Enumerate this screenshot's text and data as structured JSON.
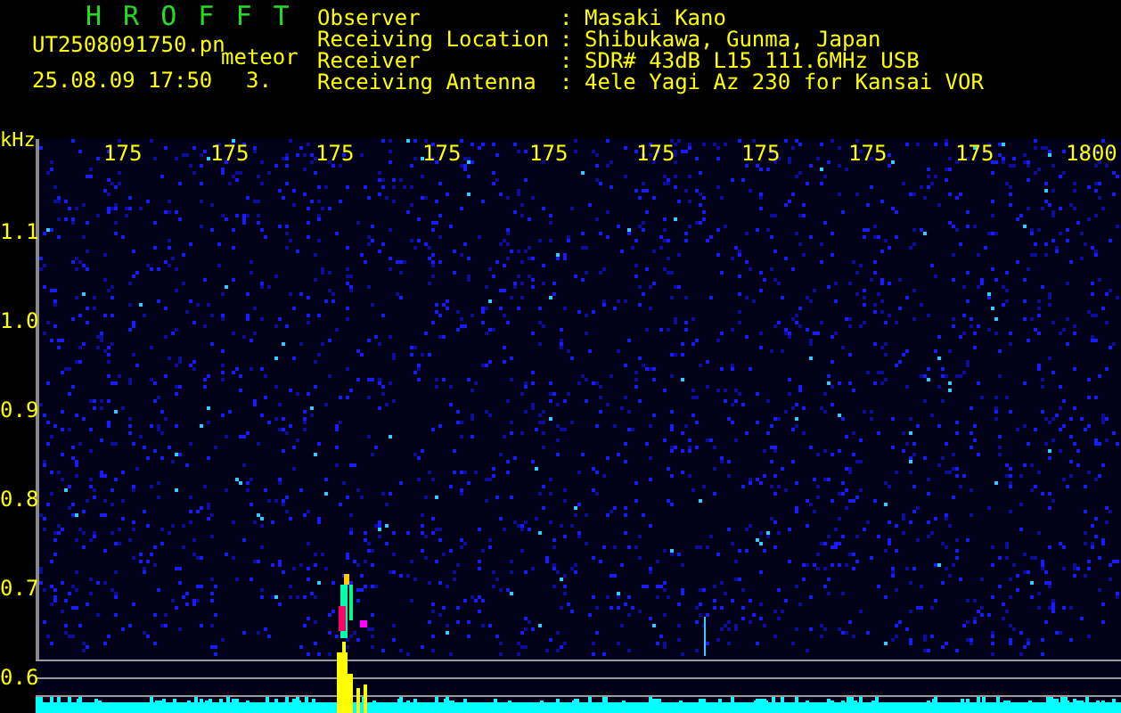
{
  "app_title": "H R O F F T",
  "file_name": "UT2508091750.pn",
  "mode": "meteor",
  "datetime": "25.08.09 17:50",
  "count": "3.",
  "info": [
    {
      "label": "Observer",
      "separator": ":",
      "value": "Masaki Kano"
    },
    {
      "label": "Receiving Location",
      "separator": ":",
      "value": "Shibukawa, Gunma, Japan"
    },
    {
      "label": "Receiver",
      "separator": ":",
      "value": "SDR# 43dB L15 111.6MHz USB"
    },
    {
      "label": "Receiving Antenna",
      "separator": ":",
      "value": "4ele Yagi Az 230 for Kansai VOR"
    }
  ],
  "unit": "kHz",
  "x_labels": [
    "175",
    "175",
    "175",
    "175",
    "175",
    "175",
    "175",
    "175",
    "175",
    "1800"
  ],
  "y_labels": [
    "1.1",
    "1.0",
    "0.9",
    "0.8",
    "0.7",
    "0.6"
  ]
}
